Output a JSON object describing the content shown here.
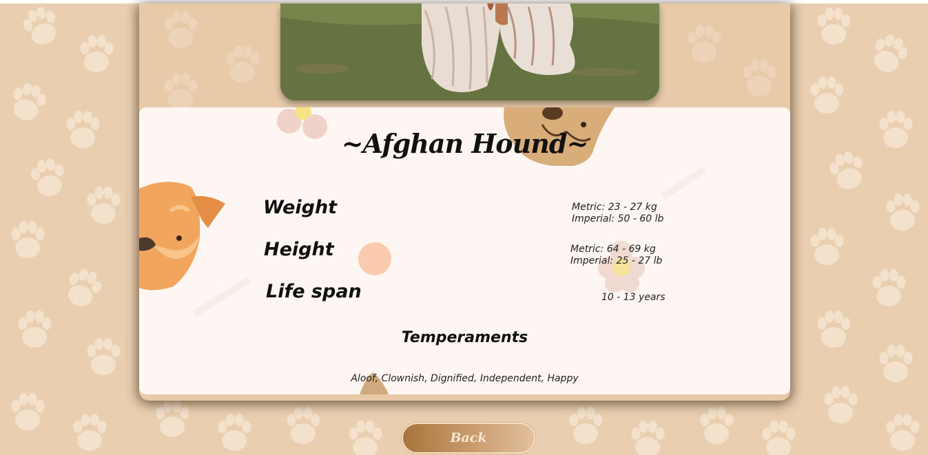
{
  "breed": {
    "title": "~Afghan Hound~",
    "stats": [
      {
        "label": "Weight",
        "values": [
          "Metric: 23 - 27 kg",
          "Imperial: 50 - 60 lb"
        ]
      },
      {
        "label": "Height",
        "values": [
          "Metric: 64 - 69 kg",
          "Imperial: 25 - 27 lb"
        ]
      },
      {
        "label": "Life span",
        "values": [
          "10 - 13 years"
        ]
      }
    ],
    "temperaments_title": "Temperaments",
    "temperaments": "Aloof, Clownish, Dignified, Independent, Happy"
  },
  "navigation": {
    "back_label": "Back"
  },
  "colors": {
    "background": "#e9cfb0",
    "panel": "#fdf6f3",
    "button_start": "#a8743c",
    "button_end": "#e2c09c"
  },
  "icons": [
    "paw-print-icon",
    "dog-face-icon",
    "flower-icon"
  ]
}
